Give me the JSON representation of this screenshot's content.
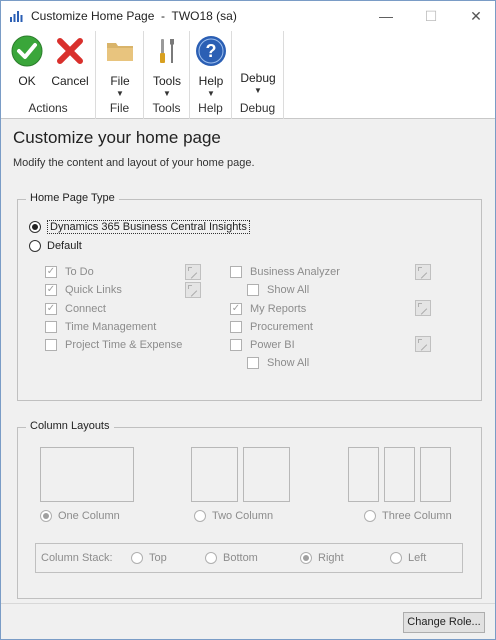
{
  "window": {
    "title": "Customize Home Page  -  TWO18 (sa)",
    "minimize_glyph": "—",
    "maximize_glyph": "☐",
    "close_glyph": "✕"
  },
  "ribbon": {
    "groups": [
      {
        "label": "Actions",
        "buttons": [
          {
            "label": "OK",
            "icon": "ok-check-icon"
          },
          {
            "label": "Cancel",
            "icon": "cancel-x-icon"
          }
        ]
      },
      {
        "label": "File",
        "buttons": [
          {
            "label": "File",
            "icon": "folder-icon",
            "caret": "▼"
          }
        ]
      },
      {
        "label": "Tools",
        "buttons": [
          {
            "label": "Tools",
            "icon": "tools-icon",
            "caret": "▼"
          }
        ]
      },
      {
        "label": "Help",
        "buttons": [
          {
            "label": "Help",
            "icon": "help-icon",
            "caret": "▼"
          }
        ]
      },
      {
        "label": "Debug",
        "buttons": [
          {
            "label": "Debug",
            "icon": "none",
            "caret": "▼"
          }
        ]
      }
    ]
  },
  "content": {
    "heading": "Customize your home page",
    "subtext": "Modify the content and layout of your home page."
  },
  "home_page_type": {
    "legend": "Home Page Type",
    "options": [
      {
        "label": "Dynamics 365 Business Central Insights",
        "selected": true
      },
      {
        "label": "Default",
        "selected": false
      }
    ],
    "left_items": [
      {
        "label": "To Do",
        "checked": true,
        "has_settings": true
      },
      {
        "label": "Quick Links",
        "checked": true,
        "has_settings": true
      },
      {
        "label": "Connect",
        "checked": true,
        "has_settings": false
      },
      {
        "label": "Time Management",
        "checked": false,
        "has_settings": false
      },
      {
        "label": "Project Time & Expense",
        "checked": false,
        "has_settings": false
      }
    ],
    "right_items": [
      {
        "label": "Business Analyzer",
        "checked": false,
        "has_settings": true
      },
      {
        "label": "Show All",
        "checked": false,
        "indent": true
      },
      {
        "label": "My Reports",
        "checked": true,
        "has_settings": true
      },
      {
        "label": "Procurement",
        "checked": false,
        "has_settings": false
      },
      {
        "label": "Power BI",
        "checked": false,
        "has_settings": true
      },
      {
        "label": "Show All",
        "checked": false,
        "indent": true
      }
    ]
  },
  "column_layouts": {
    "legend": "Column Layouts",
    "options": [
      {
        "label": "One Column",
        "selected": true
      },
      {
        "label": "Two Column",
        "selected": false
      },
      {
        "label": "Three Column",
        "selected": false
      }
    ],
    "stack": {
      "label": "Column Stack:",
      "options": [
        {
          "label": "Top",
          "selected": false
        },
        {
          "label": "Bottom",
          "selected": false
        },
        {
          "label": "Right",
          "selected": true
        },
        {
          "label": "Left",
          "selected": false
        }
      ]
    }
  },
  "footer": {
    "change_role_label": "Change Role..."
  },
  "colors": {
    "ok_green": "#3aa63a",
    "cancel_red": "#d9302c",
    "help_blue": "#2b5fb4",
    "folder_tan": "#d9b46a"
  }
}
